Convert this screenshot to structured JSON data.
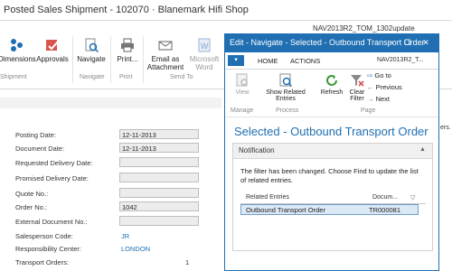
{
  "background_window": {
    "title": "Posted Sales Shipment - 102070 · Blanemark Hifi Shop",
    "user_label": "NAV2013R2_TOM_1302update",
    "ribbon": {
      "actions": [
        {
          "label": "Dimensions",
          "icon": "dimensions-icon"
        },
        {
          "label": "Approvals",
          "icon": "approvals-icon"
        },
        {
          "label": "Navigate",
          "icon": "navigate-icon"
        },
        {
          "label": "Print...",
          "icon": "printer-icon"
        },
        {
          "label": "Email as Attachment",
          "icon": "email-icon"
        },
        {
          "label": "Microsoft Word",
          "icon": "word-icon"
        }
      ],
      "groups": [
        "Shipment",
        "Navigate",
        "Print",
        "Send To"
      ]
    },
    "fields": [
      {
        "label": "Posting Date:",
        "value": "12-11-2013"
      },
      {
        "label": "Document Date:",
        "value": "12-11-2013"
      },
      {
        "label": "Requested Delivery Date:",
        "value": ""
      },
      {
        "label": "Promised Delivery Date:",
        "value": ""
      },
      {
        "label": "Quote No.:",
        "value": ""
      },
      {
        "label": "Order No.:",
        "value": "1042"
      },
      {
        "label": "External Document No.:",
        "value": ""
      },
      {
        "label": "Salesperson Code:",
        "value": "JR"
      },
      {
        "label": "Responsibility Center:",
        "value": "LONDON"
      },
      {
        "label": "Transport Orders:",
        "value": "1"
      }
    ],
    "right_edge_text": "ers."
  },
  "dialog": {
    "title": "Edit - Navigate - Selected - Outbound Transport Order",
    "window_buttons": [
      "−",
      "☐",
      "✕"
    ],
    "app_button": "▾",
    "tabs": [
      "HOME",
      "ACTIONS"
    ],
    "user_label": "NAV2013R2_T...",
    "ribbon": {
      "view": "View",
      "show_related": "Show Related Entries",
      "refresh": "Refresh",
      "clear_filter": "Clear Filter",
      "goto": "Go to",
      "previous": "Previous",
      "next": "Next",
      "groups": [
        "Manage",
        "Process",
        "Page"
      ]
    },
    "heading": "Selected - Outbound Transport Order",
    "notification": {
      "title": "Notification",
      "collapse_glyph": "▲",
      "message": "The filter has been changed. Choose Find to update the list of related entries."
    },
    "grid": {
      "columns": [
        "Related Entries",
        "Docum..."
      ],
      "rows": [
        {
          "entry": "Outbound Transport Order",
          "document": "TR000081"
        }
      ]
    }
  },
  "colors": {
    "accent": "#1f6fb2",
    "selection": "#dbe8f5"
  }
}
